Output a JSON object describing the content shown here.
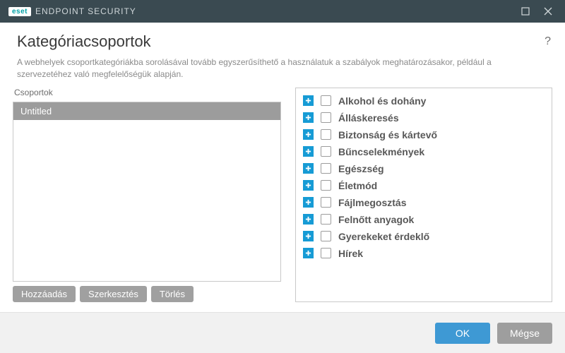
{
  "titlebar": {
    "brand_logo": "eset",
    "brand_text": "ENDPOINT SECURITY"
  },
  "header": {
    "title": "Kategóriacsoportok",
    "help": "?"
  },
  "subtitle": "A webhelyek csoportkategóriákba sorolásával tovább egyszerűsíthető a használatuk a szabályok meghatározásakor, például a szervezetéhez való megfelelőségük alapján.",
  "groups": {
    "label": "Csoportok",
    "items": [
      "Untitled"
    ],
    "buttons": {
      "add": "Hozzáadás",
      "edit": "Szerkesztés",
      "delete": "Törlés"
    }
  },
  "categories": [
    "Alkohol és dohány",
    "Álláskeresés",
    "Biztonság és kártevő",
    "Bűncselekmények",
    "Egészség",
    "Életmód",
    "Fájlmegosztás",
    "Felnőtt anyagok",
    "Gyerekeket érdeklő",
    "Hírek"
  ],
  "footer": {
    "ok": "OK",
    "cancel": "Mégse"
  }
}
